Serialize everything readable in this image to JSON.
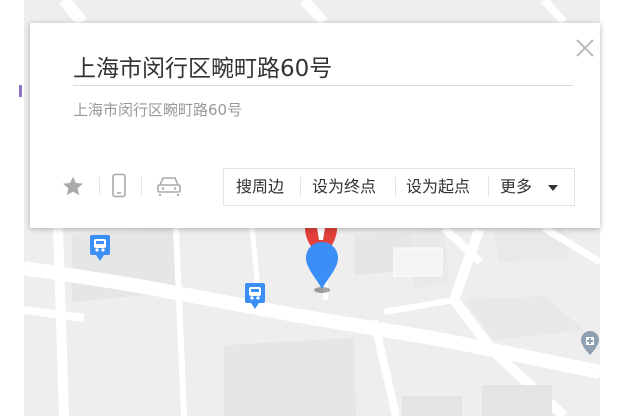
{
  "popup": {
    "title": "上海市闵行区畹町路60号",
    "address": "上海市闵行区畹町路60号"
  },
  "actions": {
    "nearby": "搜周边",
    "set_end": "设为终点",
    "set_start": "设为起点",
    "more": "更多"
  },
  "icons": {
    "favorite": "star-icon",
    "send_to_phone": "phone-icon",
    "car": "car-icon",
    "close": "close-icon",
    "bus_stop": "bus-stop-icon",
    "hospital": "hospital-icon",
    "location_pin": "map-pin-icon"
  },
  "colors": {
    "pin": "#3a8ef6",
    "alt_pin": "#e2403a",
    "bus_stop": "#3a8ef6",
    "hospital": "#8fa1b1",
    "map_land": "#eeeeee",
    "road": "#ffffff"
  }
}
